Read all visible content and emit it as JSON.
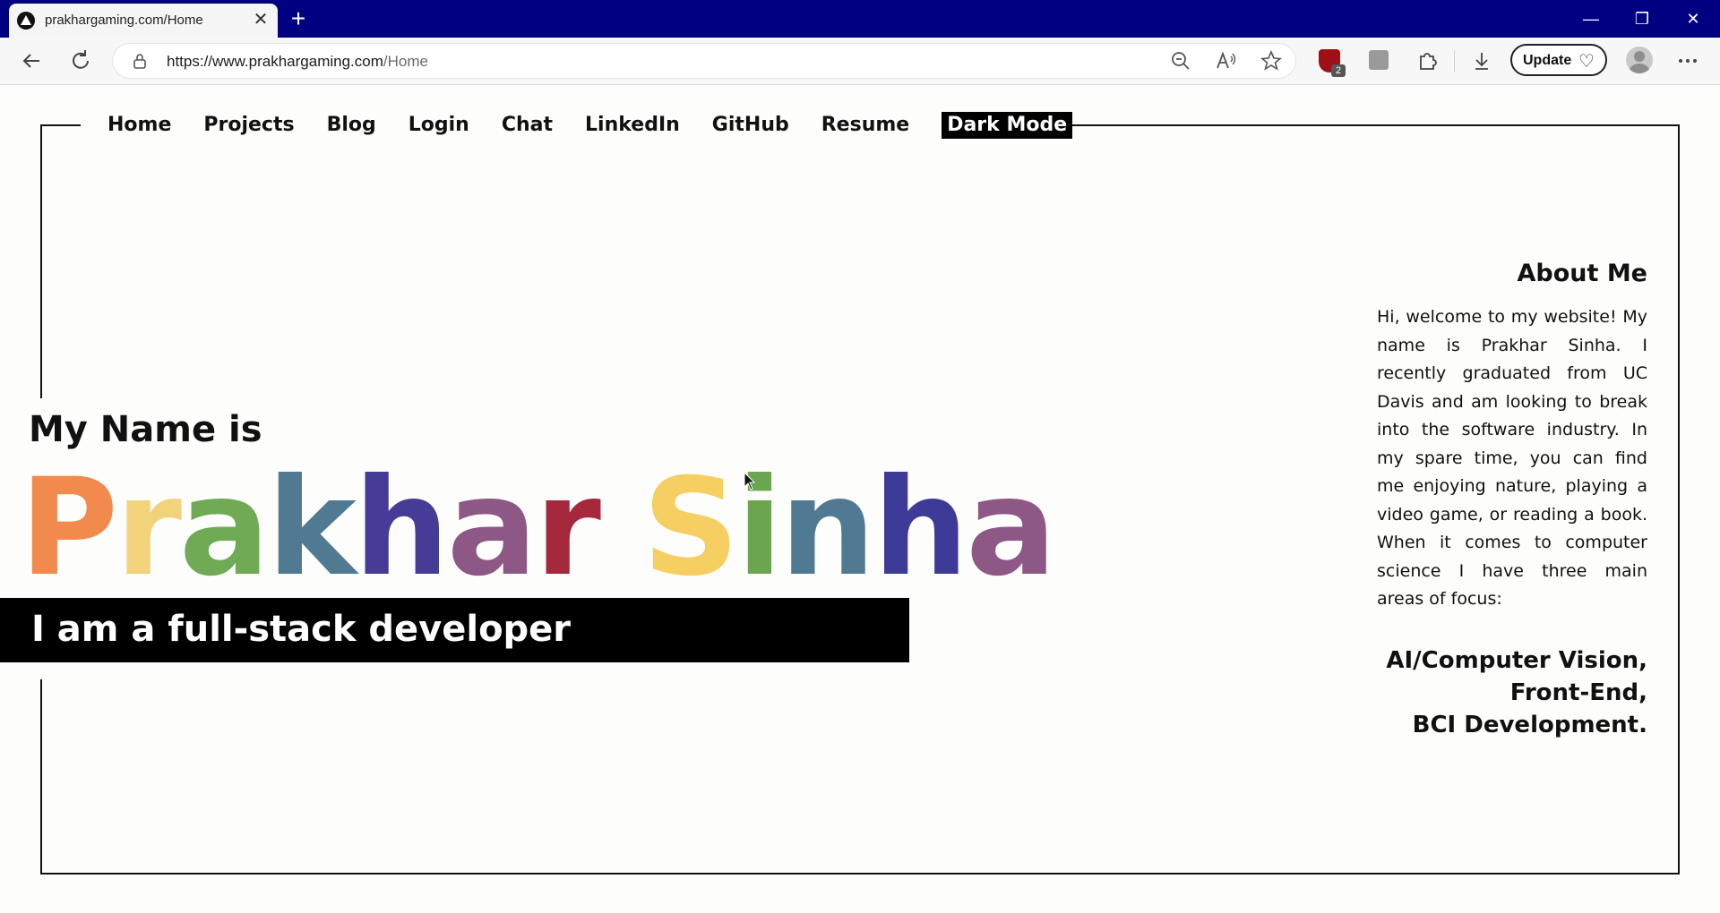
{
  "browser": {
    "tab_title": "prakhargaming.com/Home",
    "tab_close": "✕",
    "new_tab": "+",
    "url_main": "https://www.prakhargaming.com",
    "url_path": "/Home",
    "ext_badge": "2",
    "update_label": "Update",
    "window_controls": {
      "minimize": "—",
      "restore": "❐",
      "close": "✕"
    },
    "icons": [
      "back-arrow-icon",
      "refresh-icon",
      "lock-icon",
      "zoom-out-icon",
      "read-aloud-icon",
      "favorite-star-icon",
      "ublock-shield-icon",
      "extension-icon",
      "puzzle-extensions-icon",
      "download-icon",
      "heart-monitor-icon",
      "profile-avatar-icon",
      "more-menu-icon"
    ]
  },
  "nav": {
    "items": [
      "Home",
      "Projects",
      "Blog",
      "Login",
      "Chat",
      "LinkedIn",
      "GitHub",
      "Resume"
    ],
    "dark_mode": "Dark Mode"
  },
  "hero": {
    "intro": "My Name is",
    "name_letters": [
      {
        "ch": "P",
        "color": "#f28a4d"
      },
      {
        "ch": "r",
        "color": "#f2d27a"
      },
      {
        "ch": "a",
        "color": "#6faa55"
      },
      {
        "ch": "k",
        "color": "#4f7a92"
      },
      {
        "ch": "h",
        "color": "#463c97"
      },
      {
        "ch": "a",
        "color": "#8d5886"
      },
      {
        "ch": "r",
        "color": "#a6283c"
      },
      {
        "ch": " ",
        "color": "#000000"
      },
      {
        "ch": "S",
        "color": "#f5cf61"
      },
      {
        "ch": "i",
        "color": "#6aa54f"
      },
      {
        "ch": "n",
        "color": "#4f7a92"
      },
      {
        "ch": "h",
        "color": "#3e3a97"
      },
      {
        "ch": "a",
        "color": "#8d5886"
      }
    ],
    "tagline": "I am a full-stack developer"
  },
  "about": {
    "title": "About Me",
    "text": "Hi, welcome to my website! My name is Prakhar Sinha. I recently graduated from UC Davis and am looking to break into the software industry. In my spare time, you can find me enjoying nature, playing a video game, or reading a book. When it comes to computer science I have three main areas of focus:",
    "focus_areas": [
      "AI/Computer Vision,",
      "Front-End,",
      "BCI Development."
    ]
  }
}
